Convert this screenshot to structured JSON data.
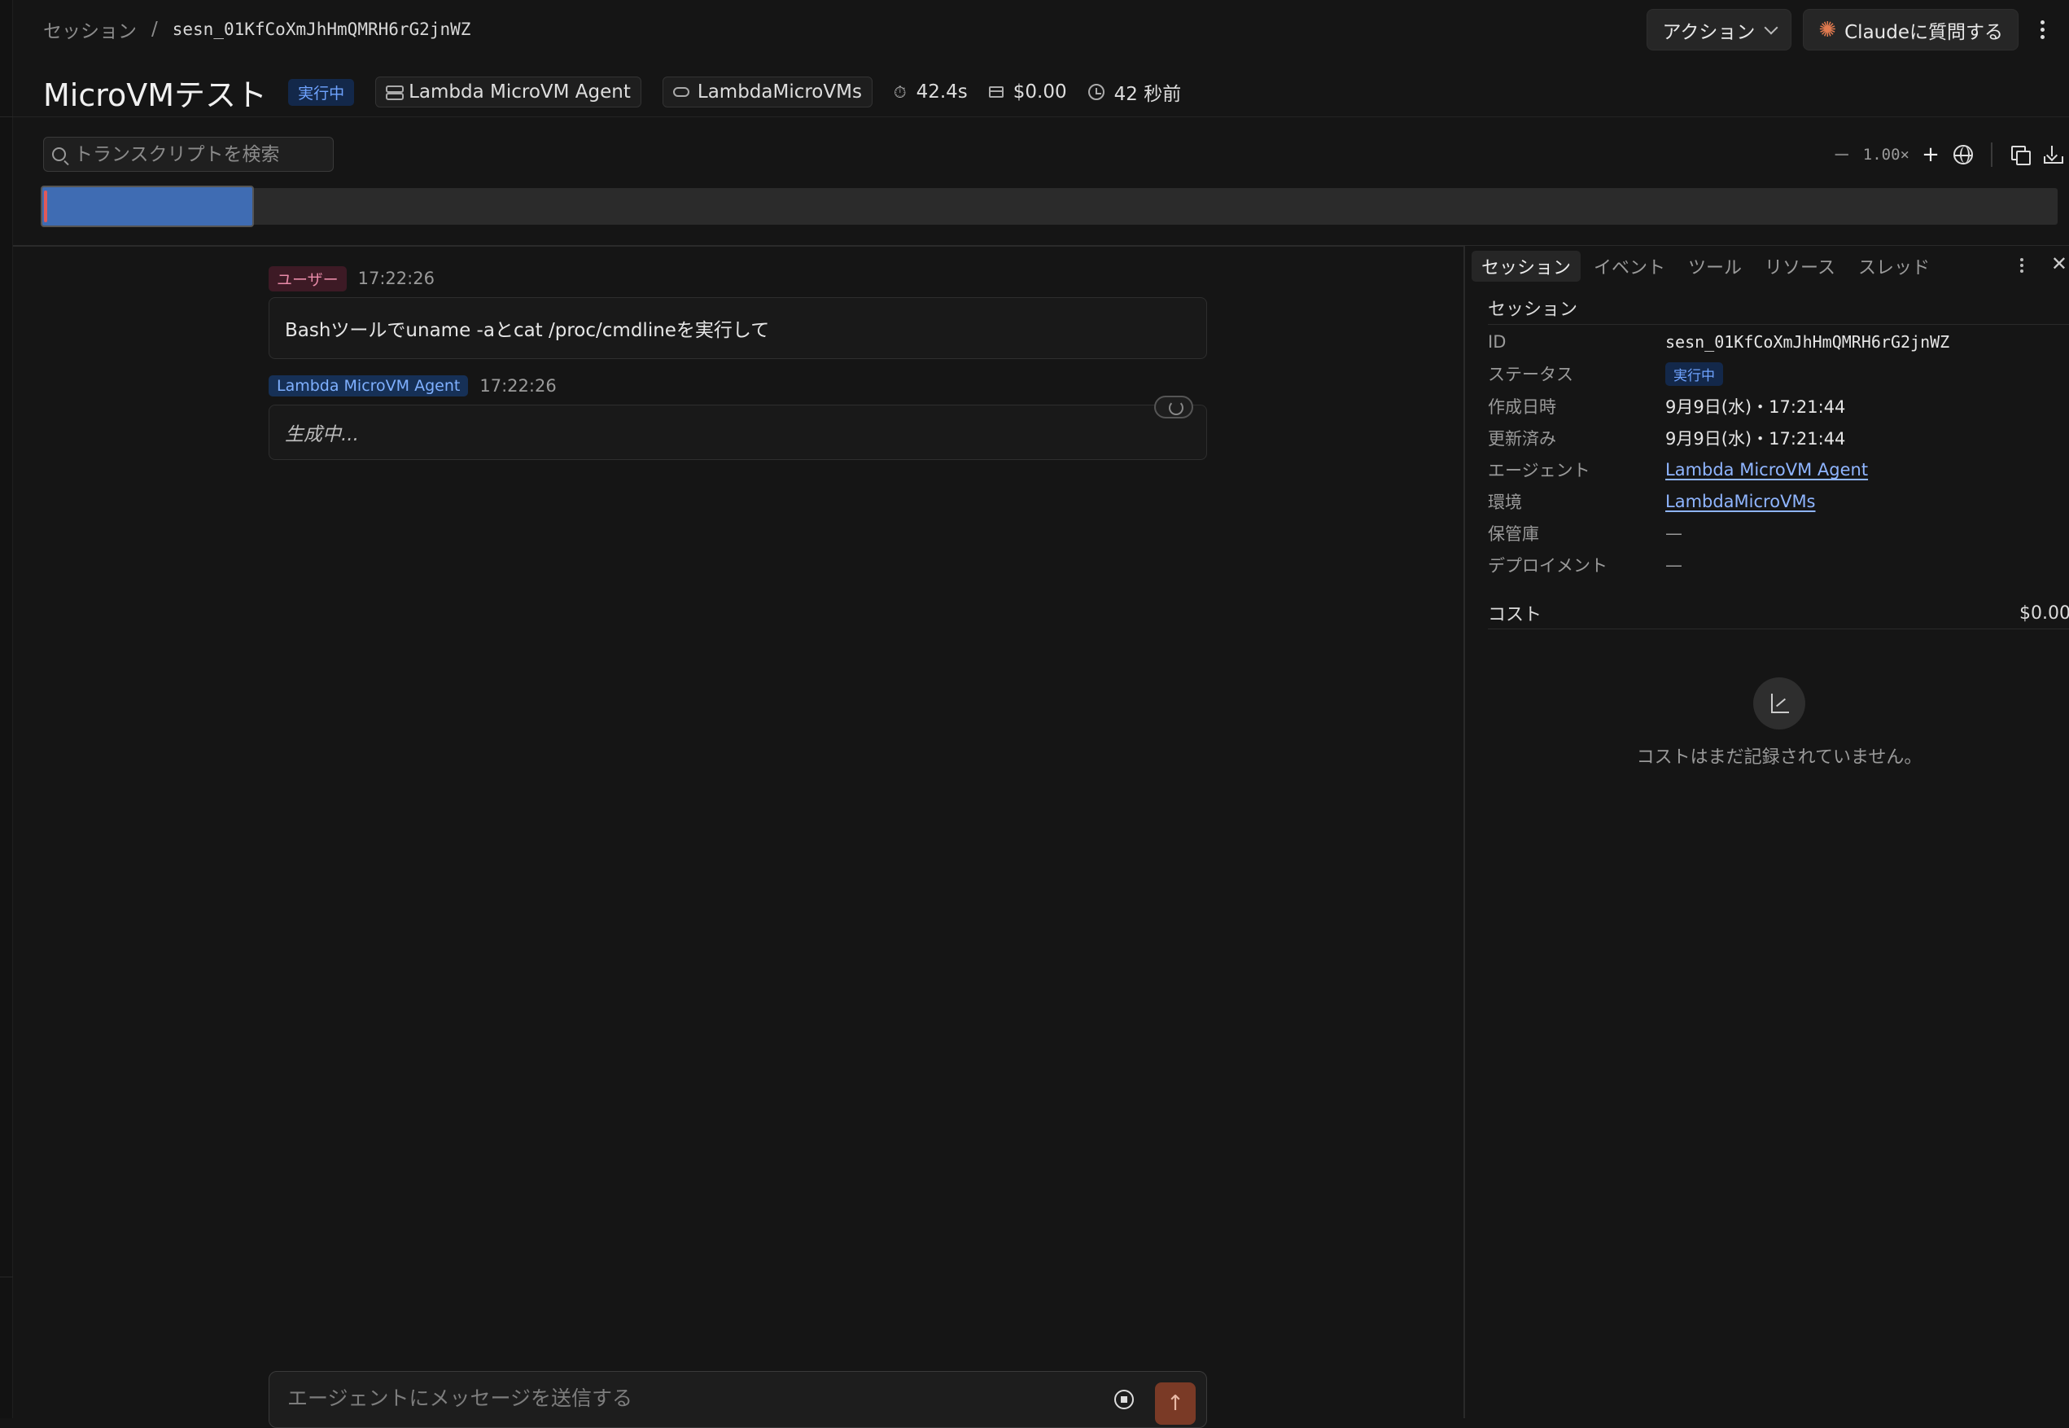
{
  "breadcrumb": {
    "root": "セッション",
    "separator": "/",
    "session_id": "sesn_01KfCoXmJhHmQMRH6rG2jnWZ"
  },
  "top_actions": {
    "actions_label": "アクション",
    "ask_claude_label": "Claudeに質問する"
  },
  "header": {
    "title": "MicroVMテスト",
    "status": "実行中",
    "agent_chip": "Lambda MicroVM Agent",
    "env_chip": "LambdaMicroVMs",
    "duration": "42.4s",
    "cost": "$0.00",
    "age": "42 秒前"
  },
  "toolbar": {
    "search_placeholder": "トランスクリプトを検索",
    "zoom_minus": "−",
    "zoom_level": "1.00×",
    "zoom_plus": "+"
  },
  "timeline": {
    "window_fraction": 0.106
  },
  "messages": [
    {
      "role": "ユーザー",
      "time": "17:22:26",
      "text": "Bashツールでuname -aとcat /proc/cmdlineを実行して"
    },
    {
      "role": "Lambda MicroVM Agent",
      "time": "17:22:26",
      "text": "生成中..."
    }
  ],
  "composer": {
    "placeholder": "エージェントにメッセージを送信する",
    "send_icon": "↑"
  },
  "panel": {
    "tabs": [
      "セッション",
      "イベント",
      "ツール",
      "リソース",
      "スレッド"
    ],
    "close": "✕",
    "section_title": "セッション",
    "fields": {
      "id": {
        "label": "ID",
        "value": "sesn_01KfCoXmJhHmQMRH6rG2jnWZ"
      },
      "status": {
        "label": "ステータス",
        "value": "実行中"
      },
      "created": {
        "label": "作成日時",
        "value": "9月9日(水)・17:21:44"
      },
      "updated": {
        "label": "更新済み",
        "value": "9月9日(水)・17:21:44"
      },
      "agent": {
        "label": "エージェント",
        "value": "Lambda MicroVM Agent"
      },
      "env": {
        "label": "環境",
        "value": "LambdaMicroVMs"
      },
      "vault": {
        "label": "保管庫",
        "value": "—"
      },
      "deployment": {
        "label": "デプロイメント",
        "value": "—"
      }
    },
    "cost_label": "コスト",
    "cost_value": "$0.00",
    "empty_text": "コストはまだ記録されていません。"
  },
  "colors": {
    "accent_blue": "#3f6cb3",
    "status_running": "#6fa3ff",
    "send_button": "#7a3a26",
    "claude_star": "#e07a4f"
  }
}
